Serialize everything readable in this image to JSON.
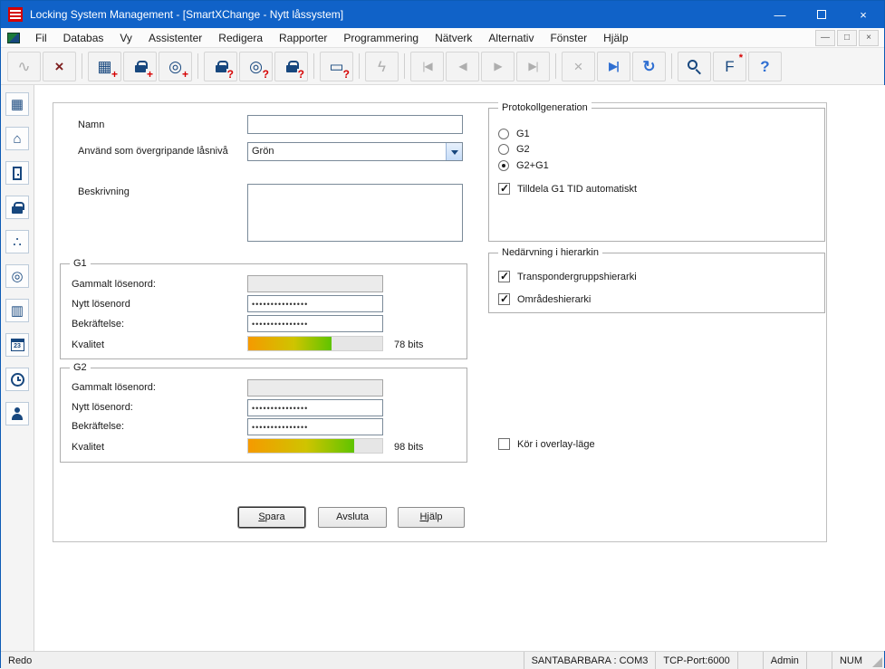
{
  "window": {
    "title": "Locking System Management - [SmartXChange - Nytt låssystem]",
    "minimize_glyph": "—",
    "close_glyph": "×"
  },
  "menu": {
    "items": [
      "Fil",
      "Databas",
      "Vy",
      "Assistenter",
      "Redigera",
      "Rapporter",
      "Programmering",
      "Nätverk",
      "Alternativ",
      "Fönster",
      "Hjälp"
    ],
    "mdi_minimize": "—",
    "mdi_restore": "□",
    "mdi_close": "×"
  },
  "toolbar": {
    "buttons": [
      {
        "name": "connect",
        "glyph": "∿",
        "badge": ""
      },
      {
        "name": "disconnect",
        "glyph": "×",
        "badge": ""
      },
      {
        "name": "new-locking-system",
        "glyph": "▦",
        "badge": "+"
      },
      {
        "name": "new-lock",
        "glyph": "",
        "badge": "+"
      },
      {
        "name": "new-transponder",
        "glyph": "◎",
        "badge": "+"
      },
      {
        "name": "read-lock",
        "glyph": "",
        "badge": "?"
      },
      {
        "name": "read-transponder",
        "glyph": "◎",
        "badge": "?"
      },
      {
        "name": "read-lock-g1",
        "glyph": "",
        "badge": "?"
      },
      {
        "name": "read-card",
        "glyph": "▭",
        "badge": "?"
      },
      {
        "name": "program",
        "glyph": "ϟ",
        "badge": ""
      },
      {
        "name": "first-record",
        "glyph": "|◀",
        "badge": ""
      },
      {
        "name": "previous-record",
        "glyph": "◀",
        "badge": ""
      },
      {
        "name": "next-record",
        "glyph": "▶",
        "badge": ""
      },
      {
        "name": "last-record",
        "glyph": "▶|",
        "badge": ""
      },
      {
        "name": "cancel",
        "glyph": "×",
        "badge": ""
      },
      {
        "name": "goto-record",
        "glyph": "▶|",
        "badge": ""
      },
      {
        "name": "refresh",
        "glyph": "↻",
        "badge": ""
      },
      {
        "name": "search",
        "glyph": "",
        "badge": ""
      },
      {
        "name": "filter-settings",
        "glyph": "F",
        "badge": "*"
      },
      {
        "name": "help",
        "glyph": "?",
        "badge": ""
      }
    ]
  },
  "sidebar": {
    "icons": [
      {
        "name": "matrix",
        "glyph": "▦"
      },
      {
        "name": "home",
        "glyph": "⌂"
      },
      {
        "name": "door",
        "glyph": ""
      },
      {
        "name": "lock",
        "glyph": ""
      },
      {
        "name": "transponder-group",
        "glyph": "∴"
      },
      {
        "name": "cylinder",
        "glyph": "◎"
      },
      {
        "name": "matrix-grid",
        "glyph": "▥"
      },
      {
        "name": "calendar",
        "glyph": "23"
      },
      {
        "name": "clock",
        "glyph": ""
      },
      {
        "name": "user",
        "glyph": ""
      }
    ]
  },
  "form": {
    "name_label": "Namn",
    "name_value": "",
    "level_label": "Använd som övergripande låsnivå",
    "level_value": "Grön",
    "description_label": "Beskrivning",
    "description_value": "",
    "g1": {
      "title": "G1",
      "old_password_label": "Gammalt lösenord:",
      "new_password_label": "Nytt lösenord",
      "confirm_label": "Bekräftelse:",
      "quality_label": "Kvalitet",
      "old_password_value": "",
      "new_password_value": "•••••••••••••••",
      "confirm_value": "•••••••••••••••",
      "quality_percent": 62,
      "bits_label": "78 bits"
    },
    "g2": {
      "title": "G2",
      "old_password_label": "Gammalt lösenord:",
      "new_password_label": "Nytt lösenord:",
      "confirm_label": "Bekräftelse:",
      "quality_label": "Kvalitet",
      "old_password_value": "",
      "new_password_value": "•••••••••••••••",
      "confirm_value": "•••••••••••••••",
      "quality_percent": 79,
      "bits_label": "98 bits"
    },
    "protocol": {
      "title": "Protokollgeneration",
      "options": [
        "G1",
        "G2",
        "G2+G1"
      ],
      "selected": "G2+G1",
      "tid_checkbox_label": "Tilldela G1 TID automatiskt",
      "tid_checked": true
    },
    "inheritance": {
      "title": "Nedärvning i hierarkin",
      "transponder_label": "Transpondergruppshierarki",
      "transponder_checked": true,
      "area_label": "Områdeshierarki",
      "area_checked": true
    },
    "overlay_label": "Kör i overlay-läge",
    "overlay_checked": false,
    "buttons": {
      "save_accel": "S",
      "save_rest": "para",
      "exit_label": "Avsluta",
      "help_accel": "H",
      "help_rest": "jälp"
    }
  },
  "statusbar": {
    "ready": "Redo",
    "com": "SANTABARBARA : COM3",
    "tcp": "TCP-Port:6000",
    "user": "Admin",
    "num": "NUM"
  }
}
